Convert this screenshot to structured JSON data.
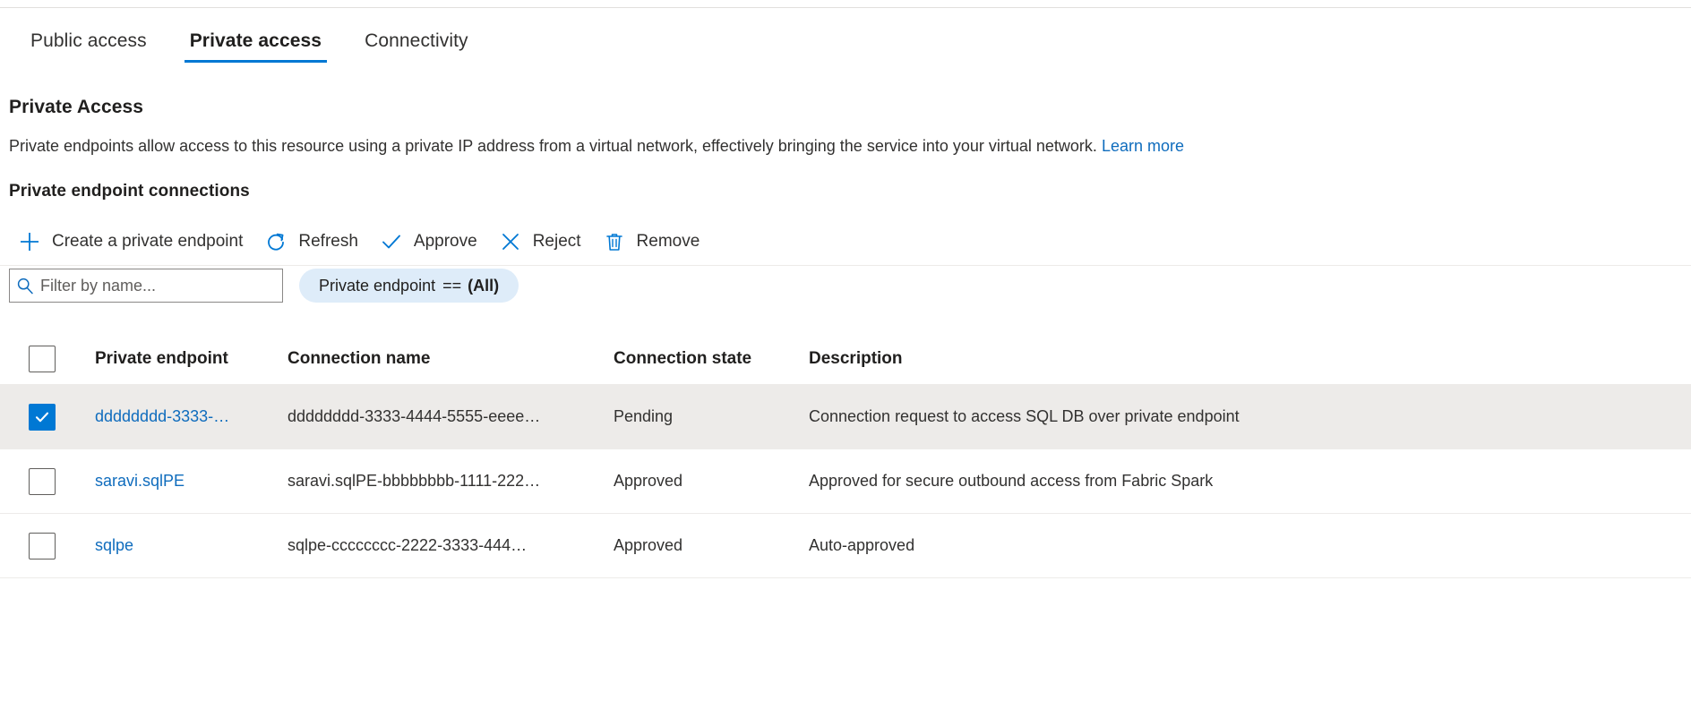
{
  "tabs": [
    {
      "label": "Public access",
      "selected": false
    },
    {
      "label": "Private access",
      "selected": true
    },
    {
      "label": "Connectivity",
      "selected": false
    }
  ],
  "section": {
    "title": "Private Access",
    "description": "Private endpoints allow access to this resource using a private IP address from a virtual network, effectively bringing the service into your virtual network.",
    "learn_more": "Learn more",
    "sub_title": "Private endpoint connections"
  },
  "commands": [
    {
      "label": "Create a private endpoint",
      "icon": "plus-icon"
    },
    {
      "label": "Refresh",
      "icon": "refresh-icon"
    },
    {
      "label": "Approve",
      "icon": "checkmark-icon"
    },
    {
      "label": "Reject",
      "icon": "cross-icon"
    },
    {
      "label": "Remove",
      "icon": "trash-icon"
    }
  ],
  "filter": {
    "search_placeholder": "Filter by name...",
    "search_value": "",
    "pill_field": "Private endpoint",
    "pill_operator": "==",
    "pill_value": "(All)"
  },
  "table": {
    "columns": [
      "Private endpoint",
      "Connection name",
      "Connection state",
      "Description"
    ],
    "rows": [
      {
        "selected": true,
        "endpoint": "dddddddd-3333-…",
        "connection_name": "dddddddd-3333-4444-5555-eeee…",
        "state": "Pending",
        "description": "Connection request to access SQL DB over private endpoint"
      },
      {
        "selected": false,
        "endpoint": "saravi.sqlPE",
        "connection_name": "saravi.sqlPE-bbbbbbbb-1111-222…",
        "state": "Approved",
        "description": "Approved for secure outbound access from Fabric Spark"
      },
      {
        "selected": false,
        "endpoint": "sqlpe",
        "connection_name": "sqlpe-cccccccc-2222-3333-444…",
        "state": "Approved",
        "description": "Auto-approved"
      }
    ]
  },
  "colors": {
    "accent": "#0078d4",
    "link": "#0f6cbd",
    "selected_row": "#edebe9",
    "pill_bg": "#deecf9"
  }
}
